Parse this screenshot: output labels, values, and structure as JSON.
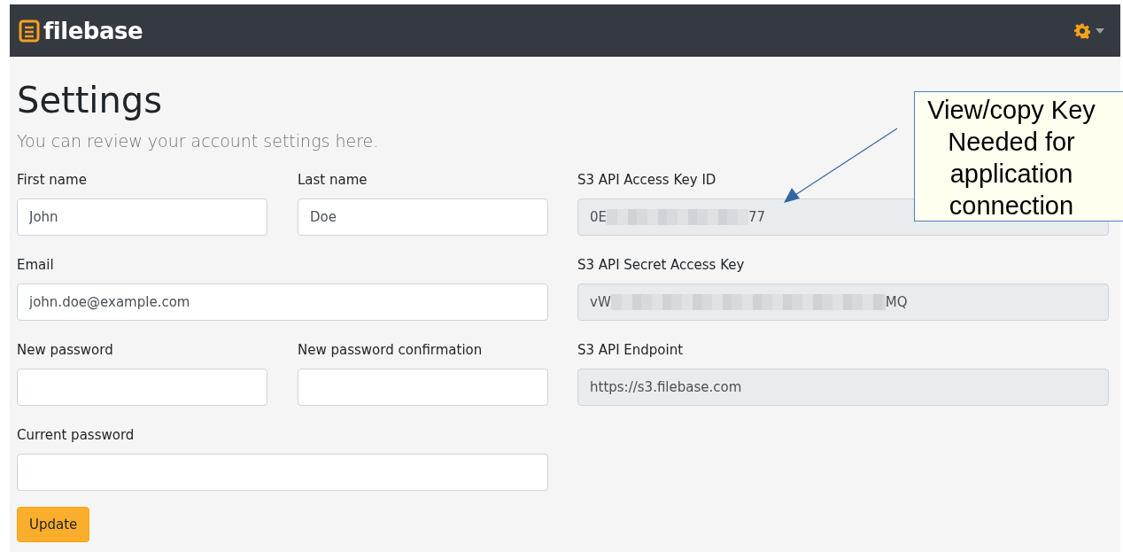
{
  "navbar": {
    "brand": "filebase",
    "settings_menu": {
      "expanded": false
    }
  },
  "title": "Settings",
  "subtitle": "You can review your account settings here.",
  "form": {
    "rows": [
      [
        {
          "label": "First name",
          "value": "John"
        },
        {
          "label": "Last name",
          "value": "Doe"
        }
      ],
      [
        {
          "label": "Email",
          "value": "john.doe@example.com"
        }
      ],
      [
        {
          "label": "New password"
        },
        {
          "label": "New password confirmation"
        }
      ],
      [
        {
          "label": "Current password"
        }
      ]
    ],
    "button": "Update"
  },
  "keys": [
    {
      "label": "S3 API Access Key ID",
      "value_start": "0E",
      "value_end": "77",
      "redacted": true
    },
    {
      "label": "S3 API Secret Access Key",
      "value_start": "vW",
      "value_end": "MQ",
      "redacted": true
    },
    {
      "label": "S3 API Endpoint",
      "value_start": "https://s3.filebase.com"
    }
  ],
  "callout": {
    "lines": [
      "View/copy Key",
      "Needed for",
      "application",
      "connection"
    ]
  }
}
